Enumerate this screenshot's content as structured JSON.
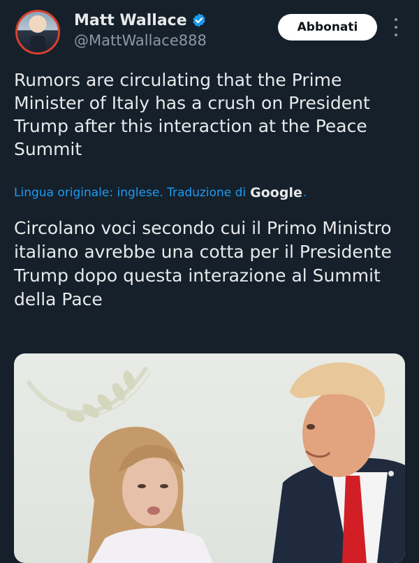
{
  "author": {
    "name": "Matt Wallace",
    "handle": "@MattWallace888",
    "verified_icon": "verified-badge-icon"
  },
  "follow_button": "Abbonati",
  "more_icon": "more-options-icon",
  "tweet": {
    "text": "Rumors are circulating that the Prime Minister of Italy has a crush on President Trump after this interaction at the Peace Summit"
  },
  "translation": {
    "label": "Lingua originale: inglese. Traduzione di",
    "provider": "Google",
    "end": ".",
    "text": "Circolano voci secondo cui il Primo Ministro italiano avrebbe una cotta per il Presidente Trump dopo questa interazione al Summit della Pace"
  },
  "colors": {
    "background": "#15202b",
    "link": "#1d9bf0",
    "verified": "#1d9bf0",
    "avatar_ring": "#d9412b"
  }
}
